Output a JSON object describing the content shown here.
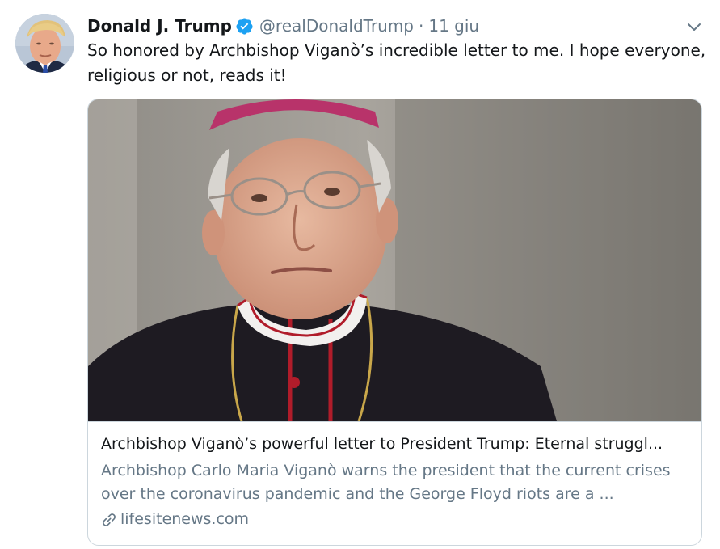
{
  "tweet": {
    "author_name": "Donald J. Trump",
    "handle": "@realDonaldTrump",
    "separator": "·",
    "timestamp": "11 giu",
    "text": "So honored by Archbishop Viganò’s incredible letter to me. I hope everyone, religious or not, reads it!",
    "verified": true
  },
  "card": {
    "title": "Archbishop Viganò’s powerful letter to President Trump: Eternal struggl...",
    "description": "Archbishop Carlo Maria Viganò warns the president that the current crises over the coronavirus pandemic and the George Floyd riots are a ...",
    "domain": "lifesitenews.com"
  },
  "icons": {
    "verified": "verified-badge-icon",
    "caret": "chevron-down-icon",
    "link": "link-icon"
  },
  "colors": {
    "verified_blue": "#1da1f2",
    "secondary_text": "#657786",
    "border": "#ccd6dd"
  }
}
